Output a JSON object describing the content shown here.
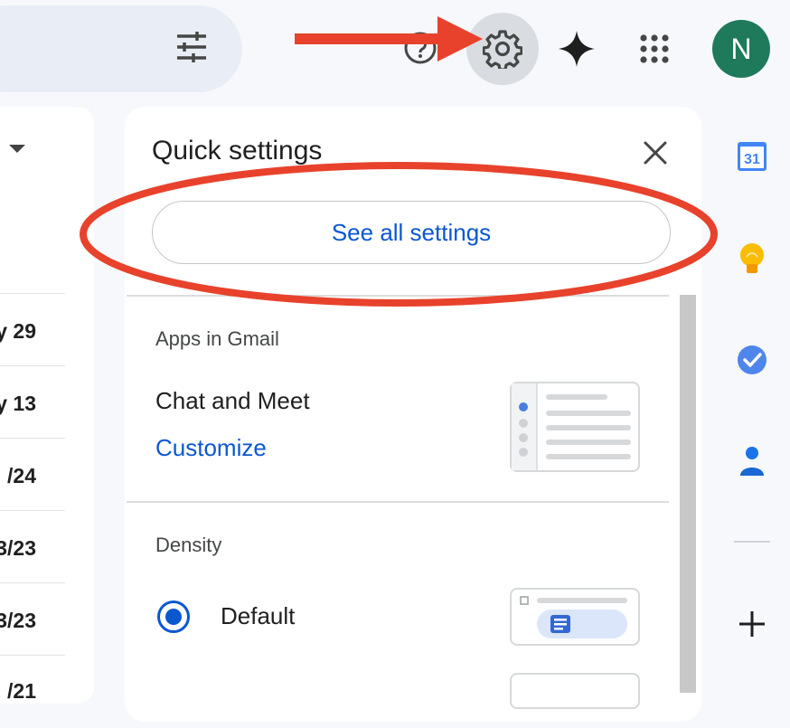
{
  "header": {
    "avatar_initial": "N",
    "icons": [
      "filter-icon",
      "help-icon",
      "settings-gear-icon",
      "gemini-icon",
      "apps-grid-icon"
    ]
  },
  "email_list": {
    "dates": [
      "y 29",
      "y 13",
      "/24",
      "3/23",
      "3/23",
      "/21"
    ]
  },
  "quick_settings": {
    "title": "Quick settings",
    "see_all_label": "See all settings",
    "apps_section": "Apps in Gmail",
    "chat_meet_label": "Chat and Meet",
    "customize_label": "Customize",
    "density_section": "Density",
    "density_default_label": "Default",
    "density_default_selected": true
  },
  "side_panel": {
    "calendar_day": "31",
    "icons": [
      "calendar-icon",
      "keep-icon",
      "tasks-icon",
      "contacts-icon",
      "add-icon"
    ]
  },
  "annotations": {
    "arrow_color": "#e8422c",
    "ellipse_color": "#e8422c"
  },
  "colors": {
    "accent": "#0b57d0",
    "avatar": "#1f7a5b"
  }
}
